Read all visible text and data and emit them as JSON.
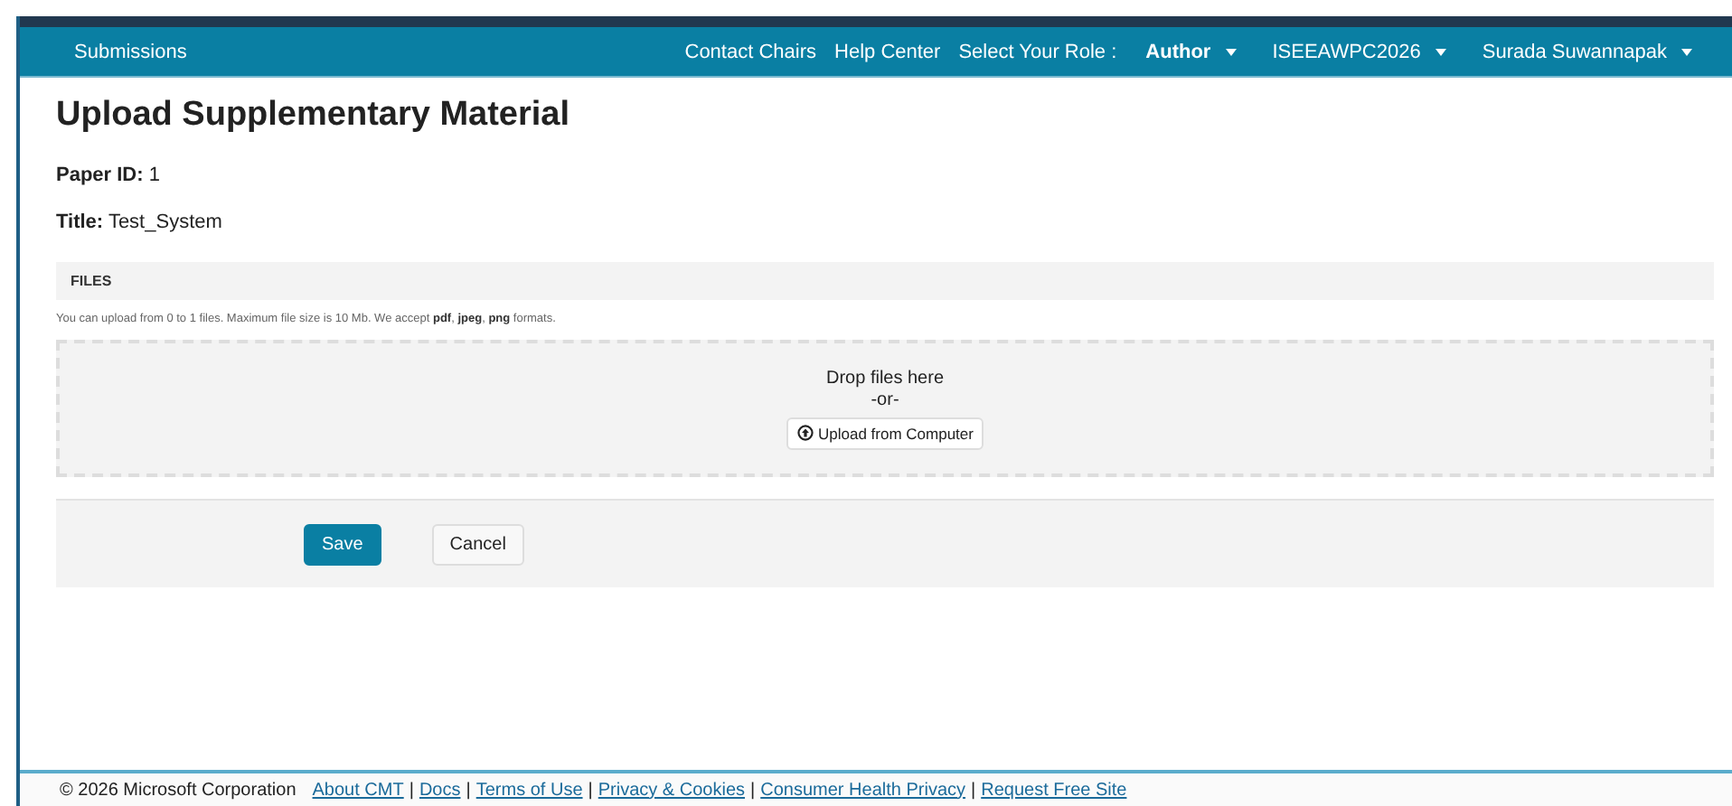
{
  "navbar": {
    "left": [
      {
        "label": "Submissions"
      }
    ],
    "right": [
      {
        "label": "Contact Chairs",
        "kind": "link"
      },
      {
        "label": "Help Center",
        "kind": "link"
      },
      {
        "label": "Select Your Role :",
        "kind": "text"
      },
      {
        "label": "Author",
        "kind": "dropdown",
        "bold": true
      },
      {
        "label": "ISEEAWPC2026",
        "kind": "dropdown",
        "bold": false
      },
      {
        "label": "Surada Suwannapak",
        "kind": "dropdown",
        "bold": false
      }
    ]
  },
  "page_title": "Upload Supplementary Material",
  "fields": [
    {
      "label": "Paper ID:",
      "value": "1"
    },
    {
      "label": "Title:",
      "value": "Test_System"
    }
  ],
  "files": {
    "heading": "FILES",
    "note": "You can upload from 0 to 1 files. Maximum file size is 10 Mb. We accept **pdf**, **jpeg**, **png** formats.",
    "drop_text": "Drop files here",
    "or_text": "-or-",
    "upload_button": "Upload from Computer"
  },
  "buttons": [
    {
      "label": "Save",
      "kind": "primary"
    },
    {
      "label": "Cancel",
      "kind": "default"
    }
  ],
  "footer": {
    "copyright": "© 2026 Microsoft Corporation",
    "separator": "|",
    "links": [
      "About CMT",
      "Docs",
      "Terms of Use",
      "Privacy & Cookies",
      "Consumer Health Privacy",
      "Request Free Site"
    ]
  }
}
